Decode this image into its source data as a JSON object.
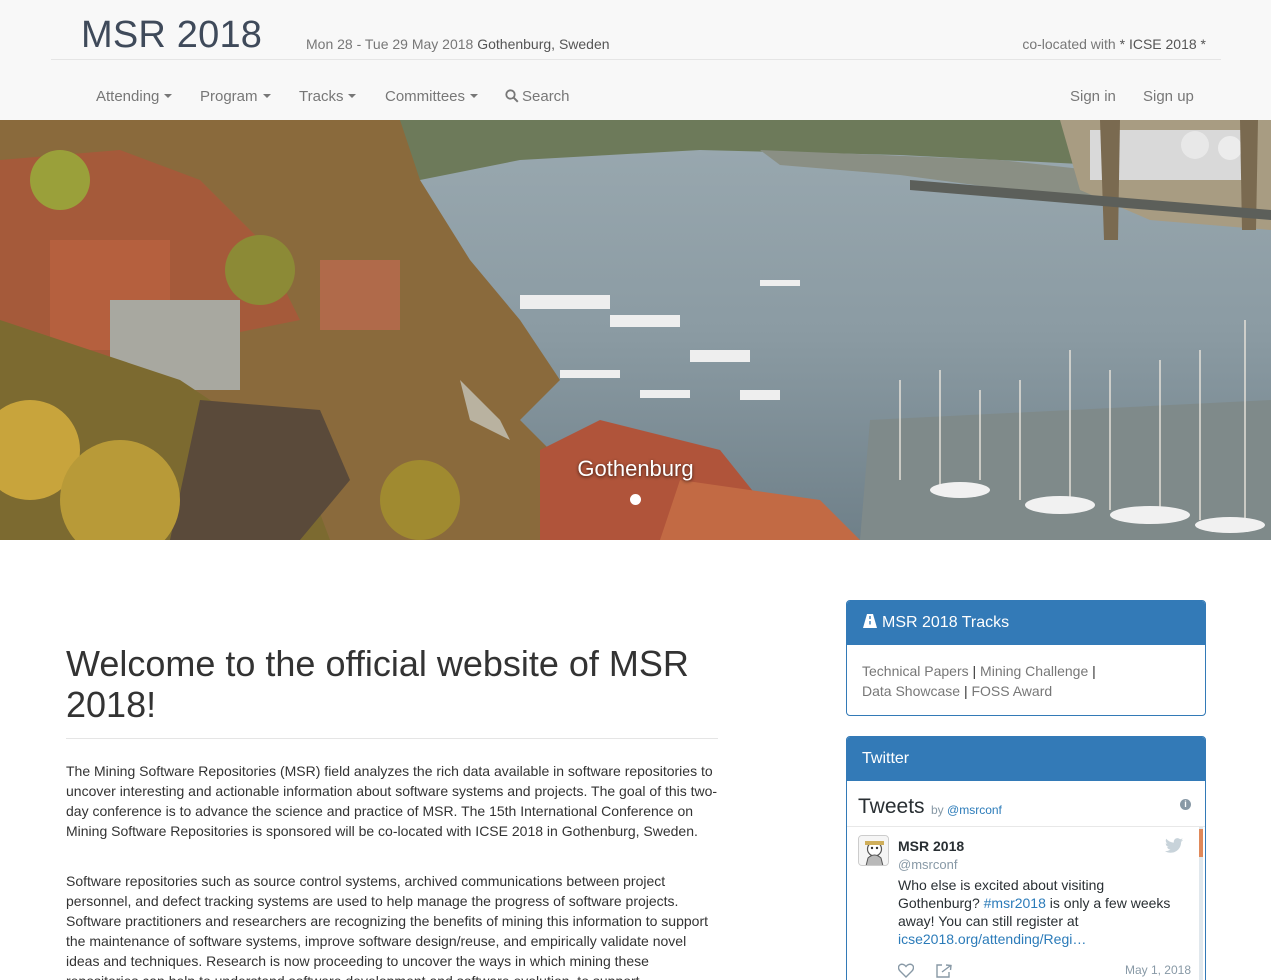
{
  "header": {
    "brand": "MSR 2018",
    "dates": "Mon 28 - Tue 29 May 2018",
    "place": "Gothenburg, Sweden",
    "colocated_prefix": "co-located with",
    "colocated_link": "* ICSE 2018 *"
  },
  "nav": {
    "items": [
      {
        "label": "Attending"
      },
      {
        "label": "Program"
      },
      {
        "label": "Tracks"
      },
      {
        "label": "Committees"
      },
      {
        "label": "Search"
      }
    ],
    "signin": "Sign in",
    "signup": "Sign up"
  },
  "hero": {
    "caption": "Gothenburg"
  },
  "main": {
    "title": "Welcome to the official website of MSR 2018!",
    "p1": "The Mining Software Repositories (MSR) field analyzes the rich data available in software repositories to uncover interesting and actionable information about software systems and projects. The goal of this two-day conference is to advance the science and practice of MSR. The 15th International Conference on Mining Software Repositories is sponsored will be co-located with ICSE 2018 in Gothenburg, Sweden.",
    "p2": "Software repositories such as source control systems, archived communications between project personnel, and defect tracking systems are used to help manage the progress of software projects. Software practitioners and researchers are recognizing the benefits of mining this information to support the maintenance of software systems, improve software design/reuse, and empirically validate novel ideas and techniques. Research is now proceeding to uncover the ways in which mining these repositories can help to understand software development and software evolution, to support"
  },
  "tracks_panel": {
    "title": "MSR 2018 Tracks",
    "links": [
      "Technical Papers",
      "Mining Challenge",
      "Data Showcase",
      "FOSS Award"
    ],
    "sep": "|"
  },
  "twitter_panel": {
    "title": "Twitter",
    "tweets_label": "Tweets",
    "by_label": "by",
    "by_handle": "@msrconf",
    "tweet": {
      "name": "MSR 2018",
      "handle": "@msrconf",
      "text_before": "Who else is excited about visiting Gothenburg?",
      "hashtag": "#msr2018",
      "text_after": "is only a few weeks away! You can still register at",
      "link": "icse2018.org/attending/Regi…",
      "date": "May 1, 2018"
    }
  },
  "colors": {
    "primary": "#337ab7",
    "navbar_bg": "#f8f8f8",
    "twitter_link": "#2b7bb9"
  }
}
